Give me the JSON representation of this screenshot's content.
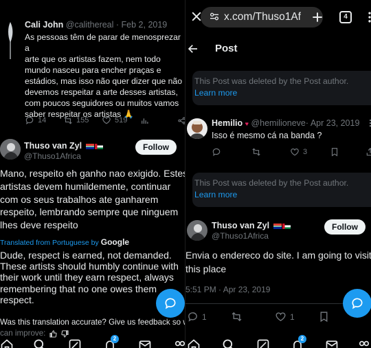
{
  "left": {
    "quoted_tweet": {
      "author_name": "Cali John",
      "handle": "@calithereal",
      "date": "· Feb 2, 2019",
      "body_lines": [
        "As pessoas têm de parar de menosprezar a",
        "arte que os artistas fazem, nem todo",
        "mundo nasceu para encher praças e",
        "estádios, mas isso não quer dizer que não",
        "devemos respeitar a arte desses artistas,",
        "com poucos seguidores ou muitos vamos",
        "saber respeitar os artistas 🙏"
      ],
      "replies": "14",
      "retweets": "155",
      "likes": "519"
    },
    "tweet": {
      "author_name": "Thuso van Zyl",
      "handle": "@Thuso1Africa",
      "follow_label": "Follow",
      "body_lines": [
        "Mano, respeito eh ganho nao exigido. Estes",
        "artistas devem humildemente, continuar",
        "com os seus trabalhos ate ganharem",
        "respeito, lembrando sempre  que ninguem",
        "lhes deve respeito"
      ],
      "translated_from": "Translated from Portuguese by",
      "translator": "Google",
      "translation_lines": [
        "Dude, respect is earned, not demanded.",
        "These artists should humbly continue with",
        "their work until they earn respect, always",
        "remembering that no one owes them",
        "respect."
      ],
      "feedback_question": "Was this translation accurate? Give us feedback so we",
      "feedback_improve": "can improve:"
    },
    "nav": {
      "notification_count": "2"
    }
  },
  "right": {
    "browser": {
      "url": "x.com/Thuso1Af",
      "tab_count": "4"
    },
    "page_title": "Post",
    "deleted_notice_1": {
      "text": "This Post was deleted by the Post author.",
      "link": "Learn more"
    },
    "reply": {
      "author_name": "Hemilio",
      "handle": "@hemilioneve·",
      "date": "Apr 23, 2019",
      "body": "Isso é mesmo cá na banda ?",
      "likes": "3"
    },
    "deleted_notice_2": {
      "text": "This Post was deleted by the Post author.",
      "link": "Learn more"
    },
    "main_tweet": {
      "author_name": "Thuso van Zyl",
      "handle": "@Thuso1Africa",
      "follow_label": "Follow",
      "body_lines": [
        "Envia o endereco do site. I am going to visit",
        "this place"
      ],
      "timestamp": "5:51 PM · Apr 23, 2019",
      "likes": "1"
    },
    "nav": {
      "notification_count": "2"
    }
  },
  "colors": {
    "accent": "#1d9bf0",
    "background": "#000000",
    "muted": "#71767b",
    "text": "#e7e9ea",
    "deleted_box": "#16181c"
  }
}
